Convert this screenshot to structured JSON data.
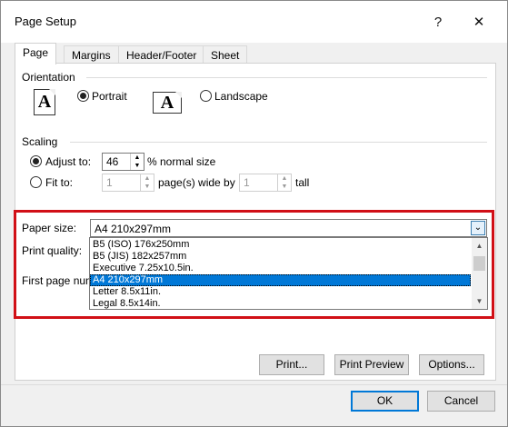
{
  "window": {
    "title": "Page Setup",
    "help_glyph": "?",
    "close_glyph": "✕"
  },
  "tabs": [
    {
      "label": "Page"
    },
    {
      "label": "Margins"
    },
    {
      "label": "Header/Footer"
    },
    {
      "label": "Sheet"
    }
  ],
  "orientation": {
    "section_label": "Orientation",
    "portrait_label": "Portrait",
    "landscape_label": "Landscape",
    "icon_letter": "A",
    "selected": "portrait"
  },
  "scaling": {
    "section_label": "Scaling",
    "adjust_label": "Adjust to:",
    "adjust_value": "46",
    "adjust_suffix": "% normal size",
    "fit_label": "Fit to:",
    "fit_wide_value": "1",
    "fit_wide_suffix": "page(s) wide by",
    "fit_tall_value": "1",
    "fit_tall_suffix": "tall",
    "selected": "adjust"
  },
  "paper": {
    "label": "Paper size:",
    "value": "A4 210x297mm",
    "options": [
      "B5 (ISO) 176x250mm",
      "B5 (JIS) 182x257mm",
      "Executive 7.25x10.5in.",
      "A4 210x297mm",
      "Letter 8.5x11in.",
      "Legal 8.5x14in."
    ],
    "selected_index": 3
  },
  "print_quality": {
    "label": "Print quality:"
  },
  "first_page": {
    "label": "First page num"
  },
  "buttons": {
    "print": "Print...",
    "print_preview": "Print Preview",
    "options": "Options...",
    "ok": "OK",
    "cancel": "Cancel"
  },
  "colors": {
    "highlight_border": "#d10f16",
    "selection": "#0078d7"
  }
}
